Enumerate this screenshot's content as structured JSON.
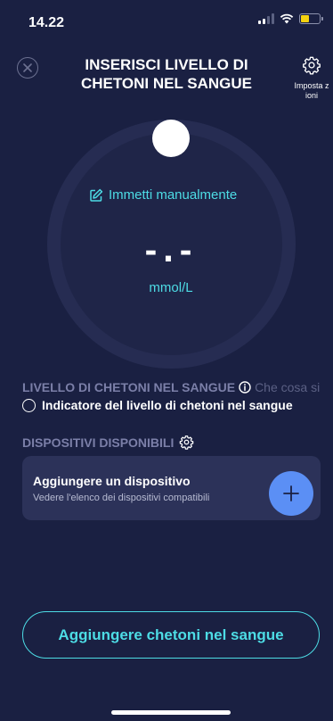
{
  "status_bar": {
    "time": "14.22",
    "battery_level": 0.45,
    "battery_color": "#f5d20f"
  },
  "header": {
    "title": "INSERISCI LIVELLO DI\nCHETONI NEL SANGUE",
    "close_icon": "close-icon",
    "settings_icon": "gear-icon",
    "settings_label": "Imposta zioni"
  },
  "gauge": {
    "manual_entry_label": "Immetti manualmente",
    "manual_entry_icon": "edit-icon",
    "value": "-.-",
    "unit": "mmol/L"
  },
  "ketone_level": {
    "section_label": "LIVELLO DI CHETONI NEL SANGUE",
    "info_icon": "info-icon",
    "info_link": "Che cosa si",
    "indicator_label": "Indicatore del livello di chetoni nel sangue"
  },
  "devices": {
    "section_label": "DISPOSITIVI DISPONIBILI",
    "settings_icon": "gear-icon",
    "card_title": "Aggiungere un dispositivo",
    "card_subtitle": "Vedere l'elenco dei dispositivi compatibili",
    "add_icon": "plus-icon"
  },
  "primary_action": {
    "label": "Aggiungere chetoni nel sangue"
  },
  "colors": {
    "background": "#1a2042",
    "accent": "#4ddce5",
    "add_button": "#5b8ff5",
    "muted": "#7b7fa8"
  }
}
